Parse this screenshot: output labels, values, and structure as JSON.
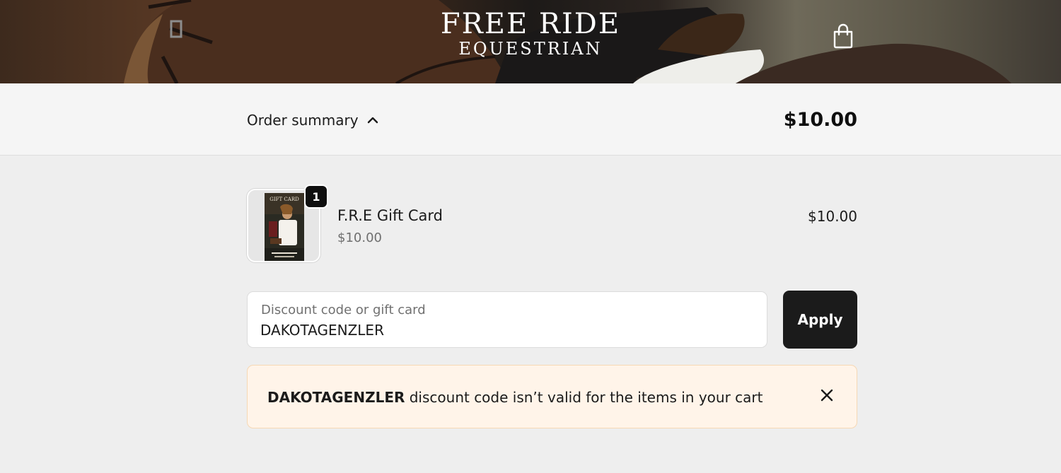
{
  "header": {
    "logo_line1": "FREE RIDE",
    "logo_line2": "EQUESTRIAN",
    "bag_icon": "shopping-bag-icon"
  },
  "summary": {
    "toggle_label": "Order summary",
    "toggle_icon": "chevron-up-icon",
    "total": "$10.00"
  },
  "line_items": [
    {
      "name": "F.R.E Gift Card",
      "unit_price": "$10.00",
      "price": "$10.00",
      "quantity": "1",
      "thumbnail_text": "GIFT CARD"
    }
  ],
  "discount": {
    "label": "Discount code or gift card",
    "value": "DAKOTAGENZLER",
    "apply_label": "Apply"
  },
  "error": {
    "code": "DAKOTAGENZLER",
    "message": " discount code isn’t valid for the items in your cart",
    "close_icon": "close-icon"
  },
  "colors": {
    "page_bg": "#eeeeee",
    "summary_bg": "#f5f5f5",
    "button_bg": "#1b1b1b",
    "alert_bg": "#fff4e9",
    "alert_border": "#f6d8b4"
  }
}
